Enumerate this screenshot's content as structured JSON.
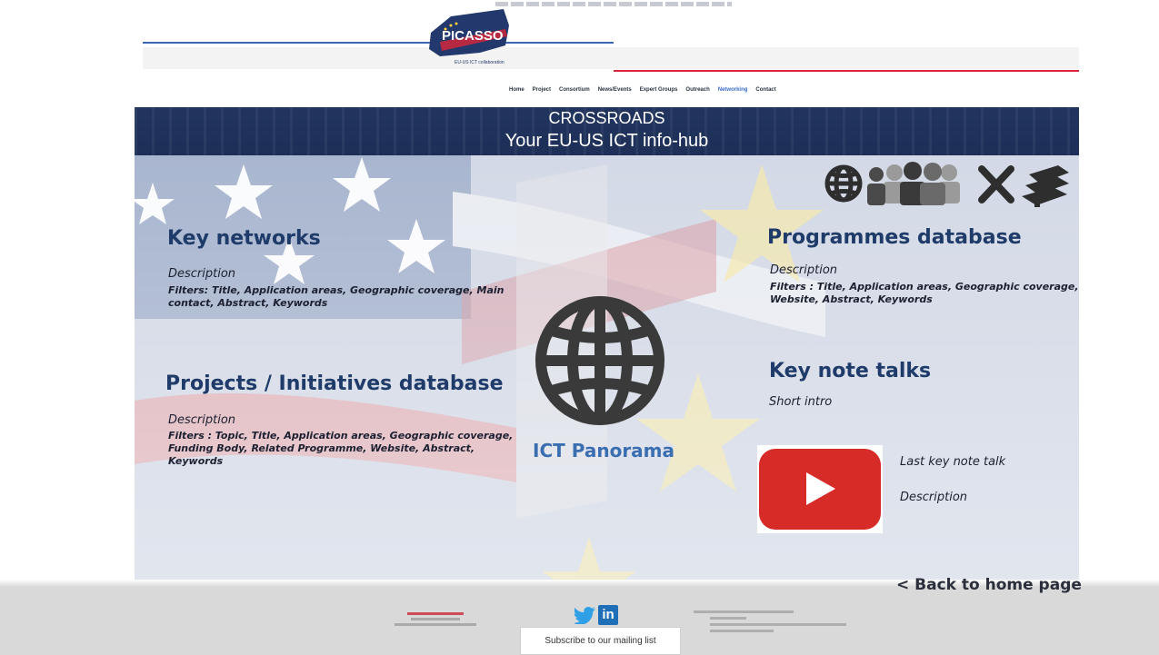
{
  "header": {
    "logo_text": "PICASSO",
    "logo_subtext": "EU-US ICT collaboration",
    "nav": [
      {
        "label": "Home"
      },
      {
        "label": "Project"
      },
      {
        "label": "Consortium"
      },
      {
        "label": "News/Events"
      },
      {
        "label": "Expert Groups"
      },
      {
        "label": "Outreach"
      },
      {
        "label": "Networking",
        "active": true
      },
      {
        "label": "Contact"
      }
    ]
  },
  "banner": {
    "title": "CROSSROADS",
    "subtitle": "Your EU-US ICT info-hub"
  },
  "sections": {
    "key_networks": {
      "title": "Key networks",
      "description": "Description",
      "filters": "Filters: Title, Application areas, Geographic coverage, Main contact, Abstract, Keywords"
    },
    "projects": {
      "title": "Projects / Initiatives database",
      "description": "Description",
      "filters": "Filters : Topic, Title, Application areas, Geographic coverage, Funding Body, Related Programme, Website, Abstract, Keywords"
    },
    "programmes": {
      "title": "Programmes database",
      "description": "Description",
      "filters": "Filters : Title, Application areas, Geographic coverage, Website, Abstract, Keywords"
    },
    "keynotes": {
      "title": "Key note talks",
      "intro": "Short intro",
      "last_talk": "Last key note talk",
      "last_description": "Description"
    }
  },
  "center": {
    "label": "ICT Panorama"
  },
  "icons": [
    "globe-icon",
    "people-icon",
    "tools-icon",
    "books-icon",
    "youtube-play-icon",
    "twitter-icon",
    "linkedin-icon"
  ],
  "back_link": "< Back to home page",
  "footer": {
    "linkedin_glyph": "in",
    "subscribe": "Subscribe to our mailing list"
  },
  "colors": {
    "banner": "#1f3158",
    "heading": "#1f3b69",
    "ict_label": "#3a6eb0",
    "nav_active": "#3a6dcc",
    "youtube": "#d72b27"
  }
}
